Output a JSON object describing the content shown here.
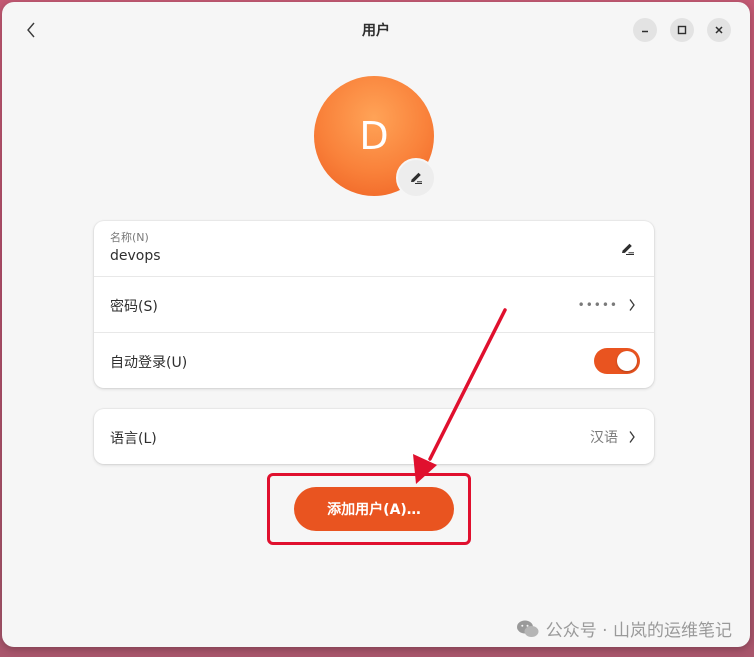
{
  "window": {
    "title": "用户"
  },
  "avatar": {
    "initial": "D"
  },
  "account": {
    "name_caption": "名称(N)",
    "name_value": "devops",
    "password_label": "密码(S)",
    "password_value": "•••••",
    "autologin_label": "自动登录(U)",
    "autologin_on": true
  },
  "language": {
    "label": "语言(L)",
    "value": "汉语"
  },
  "actions": {
    "add_user_label": "添加用户(A)…"
  },
  "watermark": {
    "text": "公众号 · 山岚的运维笔记"
  },
  "colors": {
    "accent": "#e95420",
    "annotation": "#e0102e",
    "avatar_orange": "#f9813a"
  }
}
